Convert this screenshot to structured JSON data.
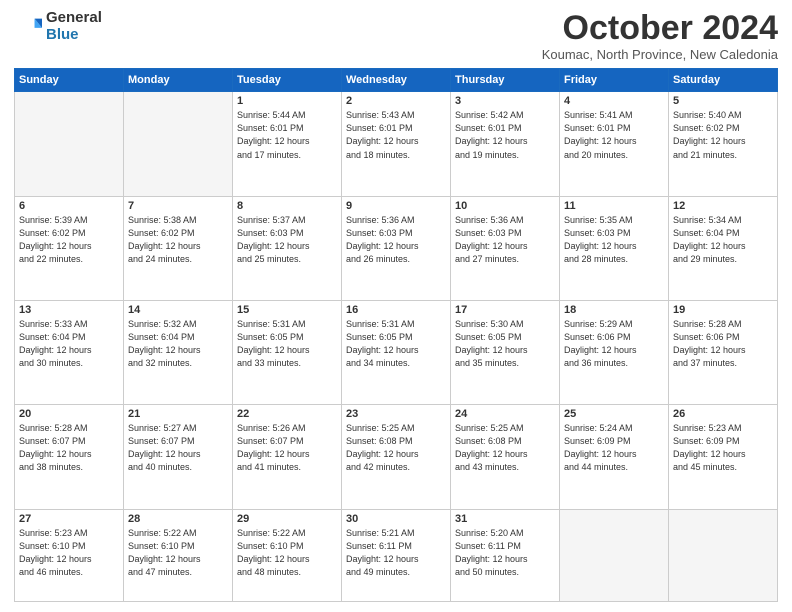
{
  "logo": {
    "general": "General",
    "blue": "Blue"
  },
  "header": {
    "month": "October 2024",
    "location": "Koumac, North Province, New Caledonia"
  },
  "days_of_week": [
    "Sunday",
    "Monday",
    "Tuesday",
    "Wednesday",
    "Thursday",
    "Friday",
    "Saturday"
  ],
  "weeks": [
    [
      {
        "day": "",
        "empty": true
      },
      {
        "day": "",
        "empty": true
      },
      {
        "day": "1",
        "sunrise": "5:44 AM",
        "sunset": "6:01 PM",
        "daylight": "12 hours and 17 minutes."
      },
      {
        "day": "2",
        "sunrise": "5:43 AM",
        "sunset": "6:01 PM",
        "daylight": "12 hours and 18 minutes."
      },
      {
        "day": "3",
        "sunrise": "5:42 AM",
        "sunset": "6:01 PM",
        "daylight": "12 hours and 19 minutes."
      },
      {
        "day": "4",
        "sunrise": "5:41 AM",
        "sunset": "6:01 PM",
        "daylight": "12 hours and 20 minutes."
      },
      {
        "day": "5",
        "sunrise": "5:40 AM",
        "sunset": "6:02 PM",
        "daylight": "12 hours and 21 minutes."
      }
    ],
    [
      {
        "day": "6",
        "sunrise": "5:39 AM",
        "sunset": "6:02 PM",
        "daylight": "12 hours and 22 minutes."
      },
      {
        "day": "7",
        "sunrise": "5:38 AM",
        "sunset": "6:02 PM",
        "daylight": "12 hours and 24 minutes."
      },
      {
        "day": "8",
        "sunrise": "5:37 AM",
        "sunset": "6:03 PM",
        "daylight": "12 hours and 25 minutes."
      },
      {
        "day": "9",
        "sunrise": "5:36 AM",
        "sunset": "6:03 PM",
        "daylight": "12 hours and 26 minutes."
      },
      {
        "day": "10",
        "sunrise": "5:36 AM",
        "sunset": "6:03 PM",
        "daylight": "12 hours and 27 minutes."
      },
      {
        "day": "11",
        "sunrise": "5:35 AM",
        "sunset": "6:03 PM",
        "daylight": "12 hours and 28 minutes."
      },
      {
        "day": "12",
        "sunrise": "5:34 AM",
        "sunset": "6:04 PM",
        "daylight": "12 hours and 29 minutes."
      }
    ],
    [
      {
        "day": "13",
        "sunrise": "5:33 AM",
        "sunset": "6:04 PM",
        "daylight": "12 hours and 30 minutes."
      },
      {
        "day": "14",
        "sunrise": "5:32 AM",
        "sunset": "6:04 PM",
        "daylight": "12 hours and 32 minutes."
      },
      {
        "day": "15",
        "sunrise": "5:31 AM",
        "sunset": "6:05 PM",
        "daylight": "12 hours and 33 minutes."
      },
      {
        "day": "16",
        "sunrise": "5:31 AM",
        "sunset": "6:05 PM",
        "daylight": "12 hours and 34 minutes."
      },
      {
        "day": "17",
        "sunrise": "5:30 AM",
        "sunset": "6:05 PM",
        "daylight": "12 hours and 35 minutes."
      },
      {
        "day": "18",
        "sunrise": "5:29 AM",
        "sunset": "6:06 PM",
        "daylight": "12 hours and 36 minutes."
      },
      {
        "day": "19",
        "sunrise": "5:28 AM",
        "sunset": "6:06 PM",
        "daylight": "12 hours and 37 minutes."
      }
    ],
    [
      {
        "day": "20",
        "sunrise": "5:28 AM",
        "sunset": "6:07 PM",
        "daylight": "12 hours and 38 minutes."
      },
      {
        "day": "21",
        "sunrise": "5:27 AM",
        "sunset": "6:07 PM",
        "daylight": "12 hours and 40 minutes."
      },
      {
        "day": "22",
        "sunrise": "5:26 AM",
        "sunset": "6:07 PM",
        "daylight": "12 hours and 41 minutes."
      },
      {
        "day": "23",
        "sunrise": "5:25 AM",
        "sunset": "6:08 PM",
        "daylight": "12 hours and 42 minutes."
      },
      {
        "day": "24",
        "sunrise": "5:25 AM",
        "sunset": "6:08 PM",
        "daylight": "12 hours and 43 minutes."
      },
      {
        "day": "25",
        "sunrise": "5:24 AM",
        "sunset": "6:09 PM",
        "daylight": "12 hours and 44 minutes."
      },
      {
        "day": "26",
        "sunrise": "5:23 AM",
        "sunset": "6:09 PM",
        "daylight": "12 hours and 45 minutes."
      }
    ],
    [
      {
        "day": "27",
        "sunrise": "5:23 AM",
        "sunset": "6:10 PM",
        "daylight": "12 hours and 46 minutes."
      },
      {
        "day": "28",
        "sunrise": "5:22 AM",
        "sunset": "6:10 PM",
        "daylight": "12 hours and 47 minutes."
      },
      {
        "day": "29",
        "sunrise": "5:22 AM",
        "sunset": "6:10 PM",
        "daylight": "12 hours and 48 minutes."
      },
      {
        "day": "30",
        "sunrise": "5:21 AM",
        "sunset": "6:11 PM",
        "daylight": "12 hours and 49 minutes."
      },
      {
        "day": "31",
        "sunrise": "5:20 AM",
        "sunset": "6:11 PM",
        "daylight": "12 hours and 50 minutes."
      },
      {
        "day": "",
        "empty": true
      },
      {
        "day": "",
        "empty": true
      }
    ]
  ],
  "labels": {
    "sunrise": "Sunrise:",
    "sunset": "Sunset:",
    "daylight": "Daylight:"
  }
}
